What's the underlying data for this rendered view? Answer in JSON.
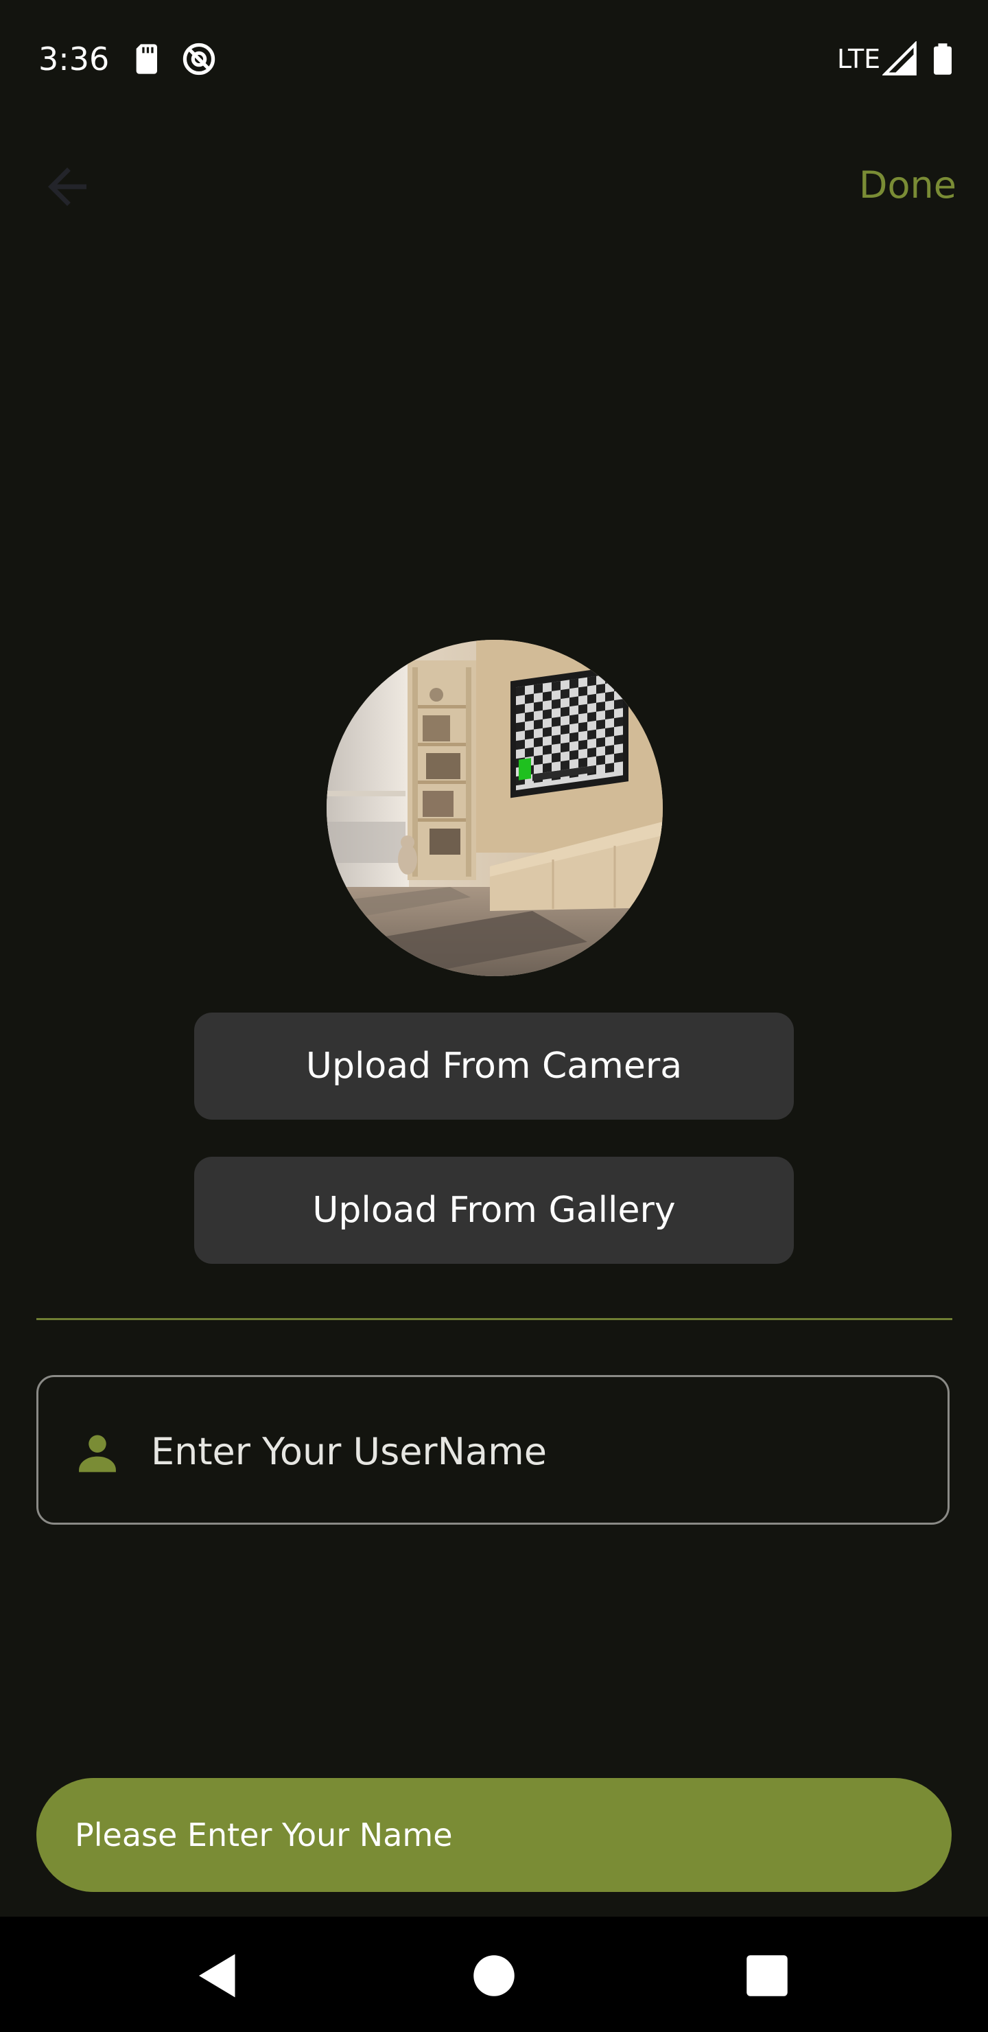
{
  "status_bar": {
    "time": "3:36",
    "network": "LTE",
    "icons": [
      "sd-card-icon",
      "vpn-icon",
      "signal-icon",
      "battery-icon"
    ]
  },
  "top_bar": {
    "done_label": "Done",
    "back_icon": "arrow-left-icon"
  },
  "profile": {
    "avatar_icon": "avatar-photo"
  },
  "buttons": {
    "upload_camera": "Upload From Camera",
    "upload_gallery": "Upload From Gallery"
  },
  "username_field": {
    "placeholder": "Enter Your UserName",
    "value": "",
    "icon": "person-icon"
  },
  "toast": {
    "message": "Please Enter Your Name"
  },
  "nav_bar": {
    "icons": [
      "back-triangle-icon",
      "home-circle-icon",
      "recents-square-icon"
    ]
  },
  "colors": {
    "background": "#13140f",
    "accent": "#7a8c35",
    "button": "#333333",
    "text": "#ffffff"
  }
}
